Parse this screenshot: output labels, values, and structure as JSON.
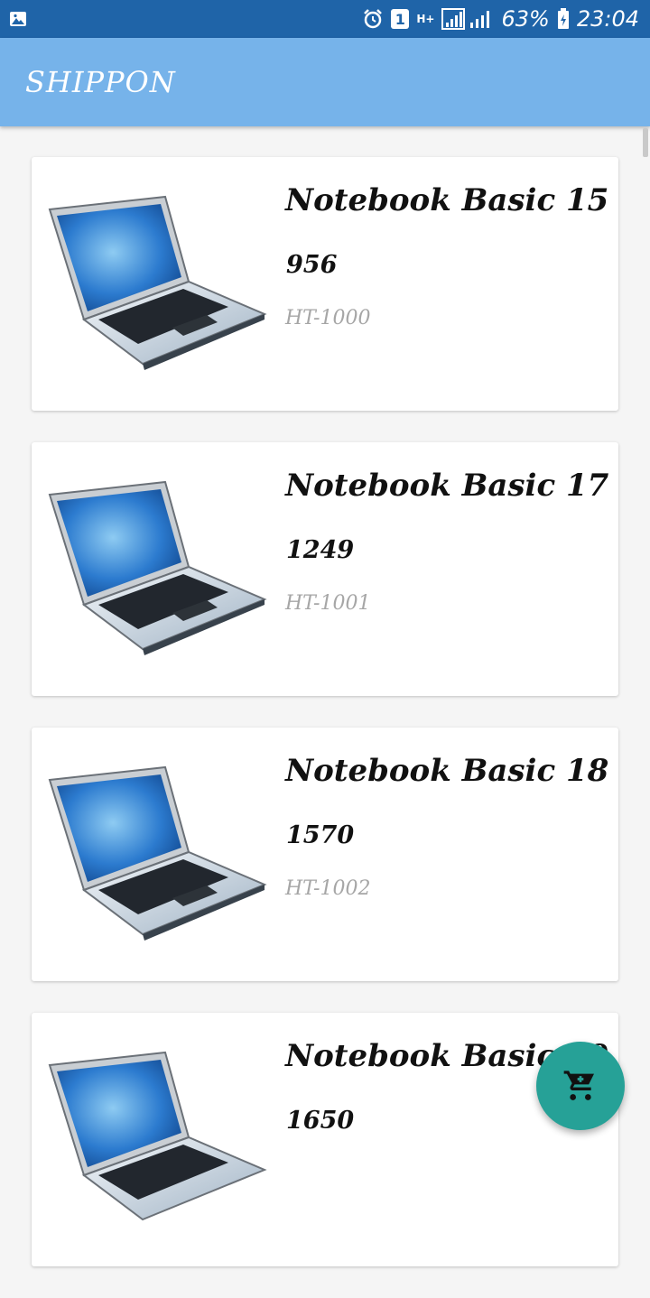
{
  "status_bar": {
    "notification_badge": "1",
    "network": "H+",
    "battery": "63%",
    "time": "23:04",
    "icons": [
      "image-icon",
      "alarm-icon",
      "signal-icon",
      "battery-icon"
    ]
  },
  "app_bar": {
    "title": "SHIPPON"
  },
  "products": [
    {
      "name": "Notebook Basic 15",
      "price": "956",
      "code": "HT-1000",
      "image": "laptop-image"
    },
    {
      "name": "Notebook Basic 17",
      "price": "1249",
      "code": "HT-1001",
      "image": "laptop-image"
    },
    {
      "name": "Notebook Basic 18",
      "price": "1570",
      "code": "HT-1002",
      "image": "laptop-image"
    },
    {
      "name": "Notebook Basic 19",
      "price": "1650",
      "code": "",
      "image": "laptop-image"
    }
  ],
  "fab": {
    "icon": "add-to-cart-icon",
    "color": "#26a197"
  },
  "colors": {
    "status_bar": "#1f64a8",
    "app_bar": "#76b3ea",
    "background": "#f5f5f5"
  }
}
